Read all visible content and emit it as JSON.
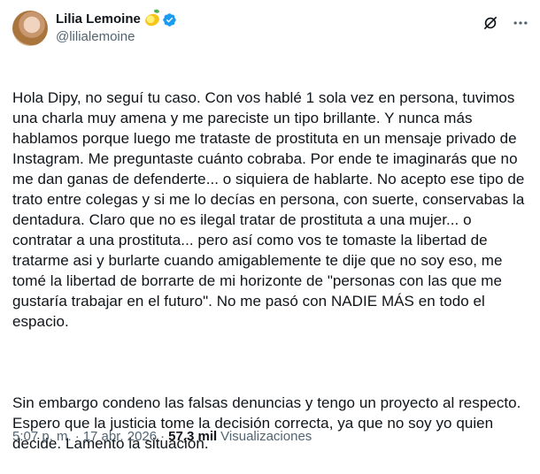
{
  "author": {
    "name": "Lilia Lemoine",
    "emoji_icon": "lemon-emoji-icon",
    "verified_icon": "verified-badge-icon",
    "verified_color": "#1d9bf0",
    "handle": "@lilialemoine"
  },
  "header_actions": {
    "grok_icon": "grok-icon",
    "more_icon": "more-icon"
  },
  "tweet": {
    "paragraph_1": "Hola Dipy, no seguí tu caso. Con vos hablé 1 sola vez en persona, tuvimos una charla muy amena y me pareciste un tipo brillante. Y nunca más hablamos porque luego me trataste de prostituta en un mensaje privado de Instagram.  Me preguntaste cuánto cobraba. Por ende  te imaginarás que no me dan ganas de defenderte... o siquiera de hablarte. No acepto ese tipo de trato entre colegas y si me lo decías en persona, con suerte, conservabas la dentadura. Claro que no es ilegal tratar de prostituta a una mujer... o contratar a una prostituta... pero así como vos te tomaste la libertad de tratarme asi y burlarte cuando amigablemente te dije que no soy eso, me tomé la libertad de borrarte de mi horizonte de \"personas con las que me gustaría trabajar en el futuro\". No me pasó con NADIE MÁS en todo el espacio.",
    "paragraph_2": "Sin embargo condeno las falsas denuncias y tengo un proyecto al respecto. Espero que la justicia tome la decisión correcta, ya que no soy yo quien decide. Lamento la situación."
  },
  "meta": {
    "time": "5:07 p. m.",
    "separator": "·",
    "date": "17 abr. 2026",
    "views_count": "57,3 mil",
    "views_label": "Visualizaciones"
  }
}
